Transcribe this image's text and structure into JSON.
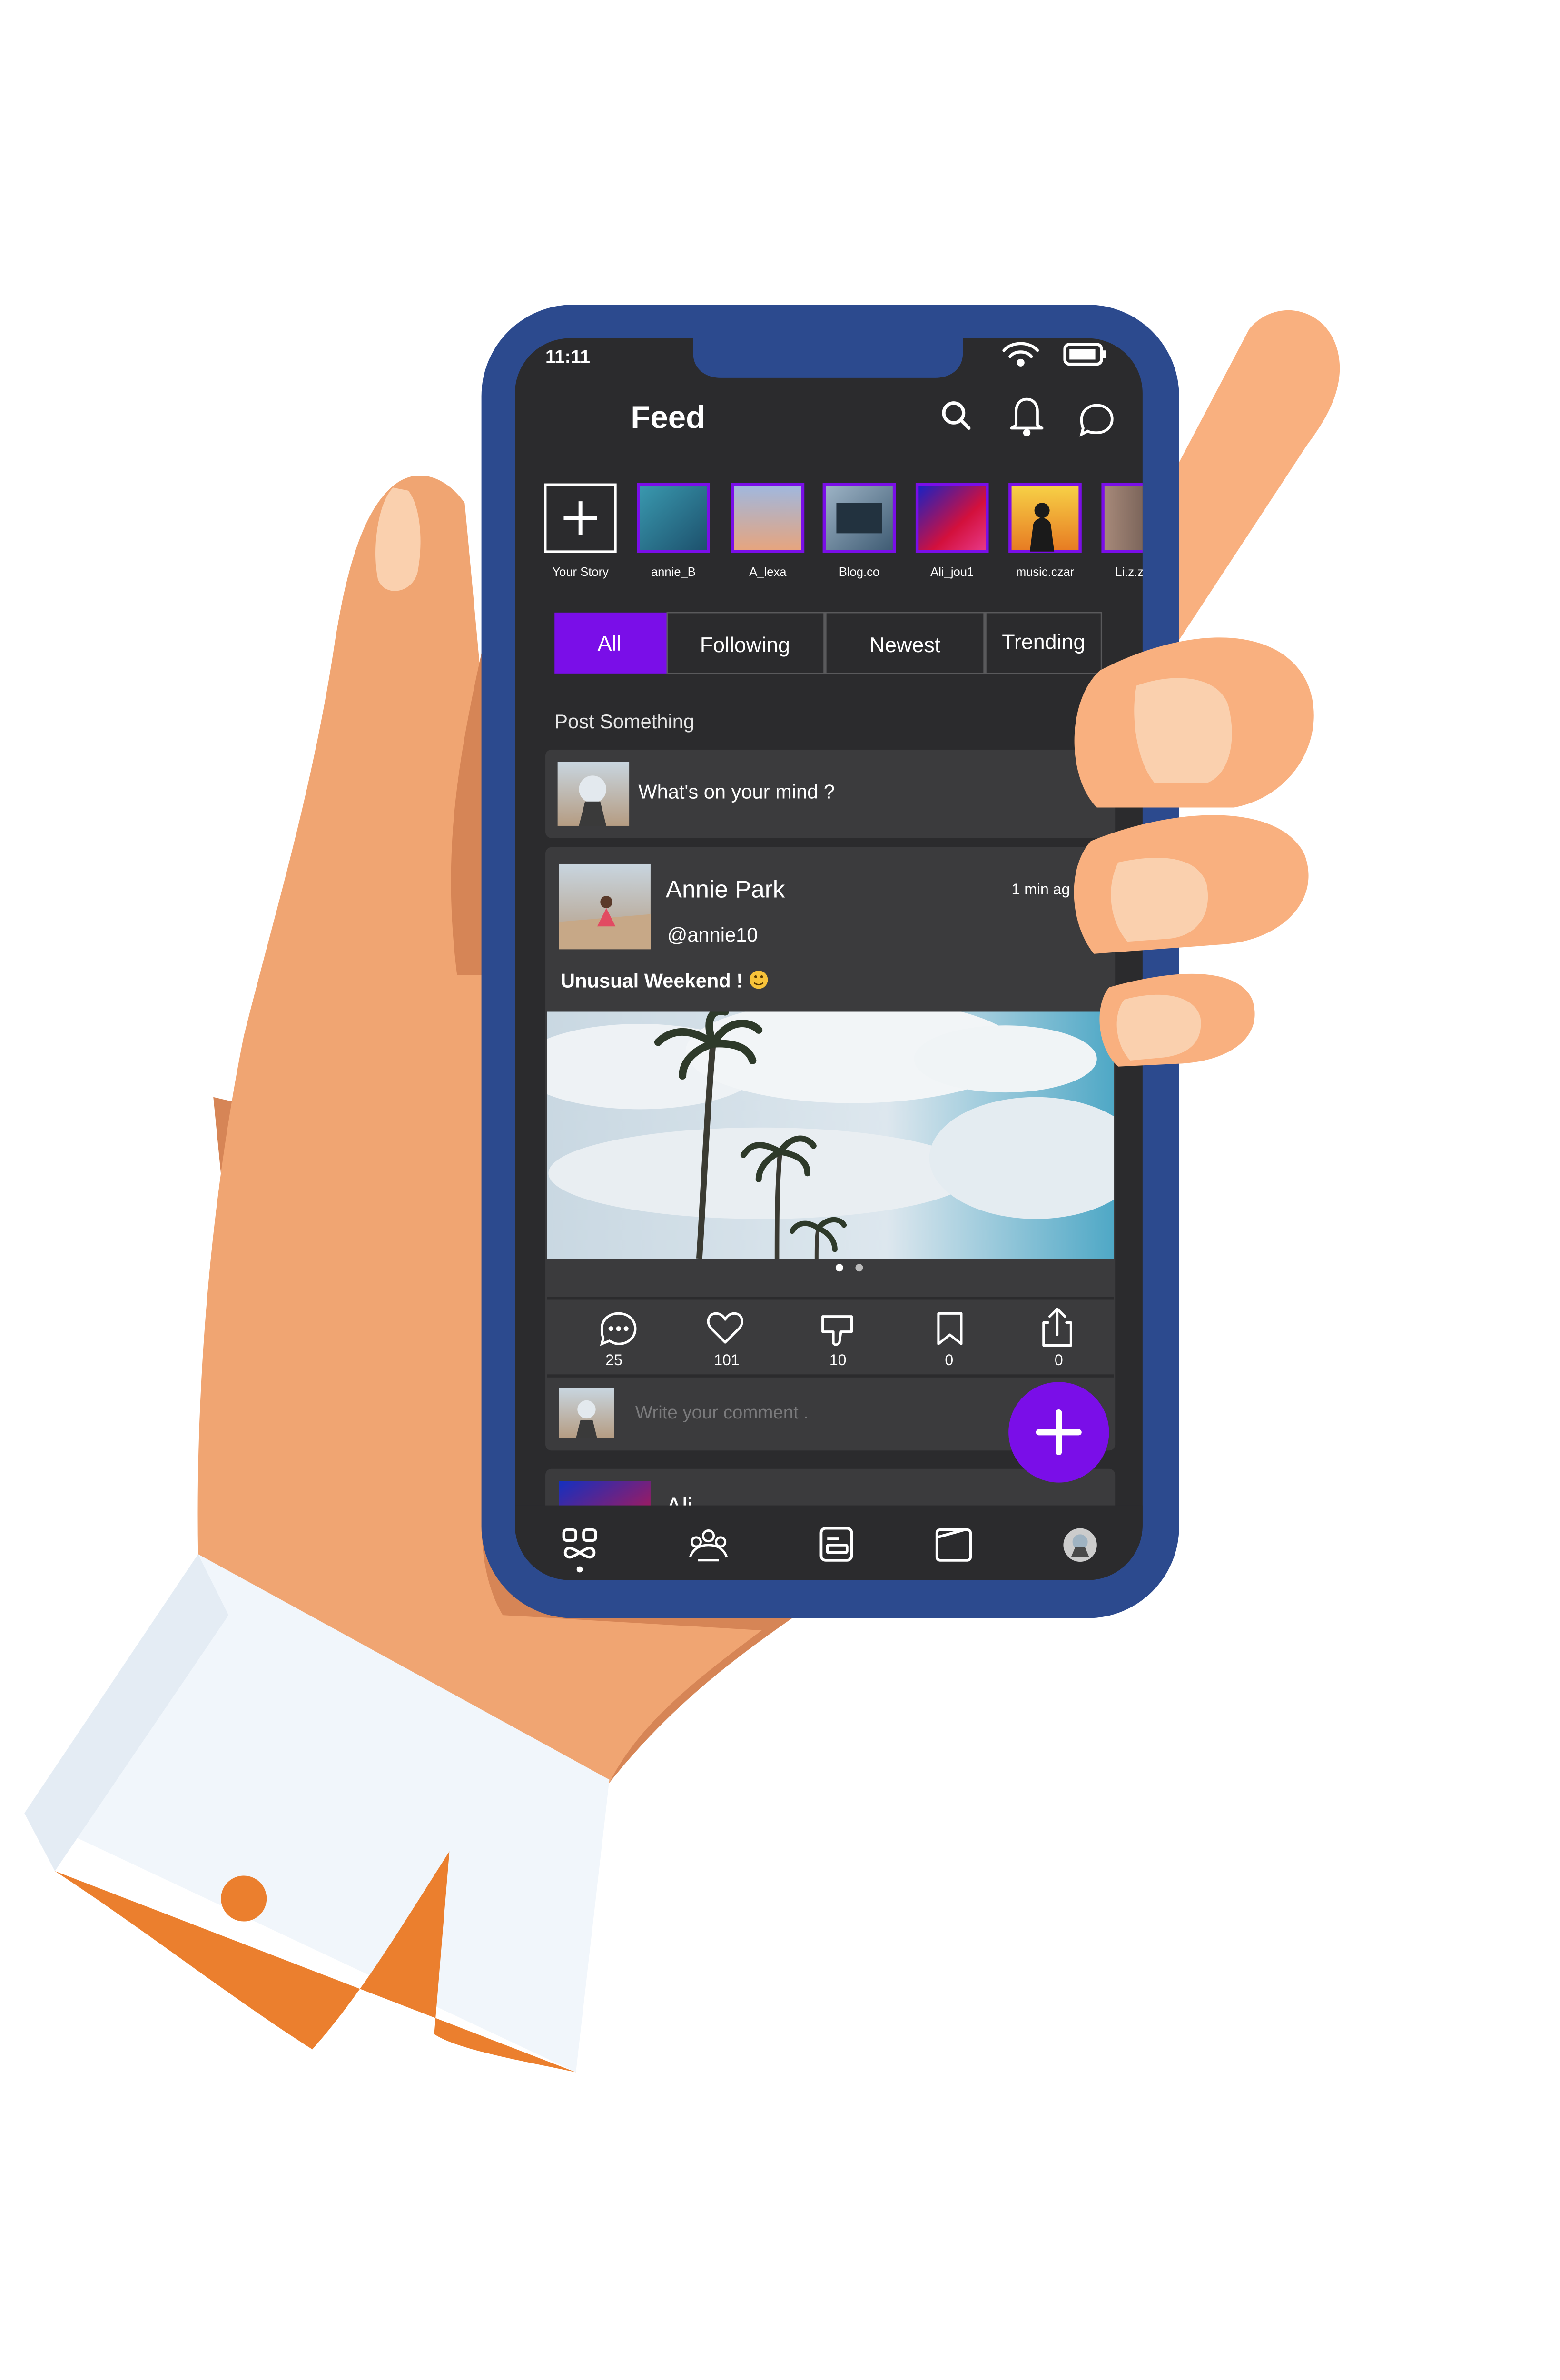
{
  "status_bar": {
    "time": "11:11"
  },
  "header": {
    "title": "Feed",
    "icons": [
      "search-icon",
      "bell-icon",
      "chat-icon"
    ]
  },
  "stories": [
    {
      "label": "Your Story"
    },
    {
      "label": "annie_B"
    },
    {
      "label": "A_lexa"
    },
    {
      "label": "Blog.co"
    },
    {
      "label": "Ali_jou1"
    },
    {
      "label": "music.czar"
    },
    {
      "label": "Li.z.z"
    }
  ],
  "tabs": [
    {
      "label": "All",
      "active": true
    },
    {
      "label": "Following",
      "active": false
    },
    {
      "label": "Newest",
      "active": false
    },
    {
      "label": "Trending",
      "active": false
    }
  ],
  "composer": {
    "section_label": "Post Something",
    "placeholder": "What's on your mind ?"
  },
  "post": {
    "author": "Annie Park",
    "handle": "@annie10",
    "time": "1 min ag",
    "caption": "Unusual Weekend !",
    "carousel": {
      "count": 2,
      "active": 1
    },
    "actions": [
      {
        "icon": "comment-icon",
        "count": "25"
      },
      {
        "icon": "heart-icon",
        "count": "101"
      },
      {
        "icon": "dislike-icon",
        "count": "10"
      },
      {
        "icon": "bookmark-icon",
        "count": "0"
      },
      {
        "icon": "share-icon",
        "count": "0"
      }
    ],
    "comment_placeholder": "Write your comment ."
  },
  "next_post": {
    "author": "Ali"
  },
  "bottom_nav": [
    "feed-icon",
    "community-icon",
    "posts-icon",
    "wallet-icon",
    "profile-avatar"
  ],
  "colors": {
    "accent": "#7A0EE8",
    "phone_frame": "#2C4A8E",
    "screen_bg": "#2B2B2D",
    "card_bg": "#3B3B3D",
    "skin": "#F0A572",
    "skin_shadow": "#D68556",
    "cuff": "#F1F6FB",
    "cuff_orange": "#EB7F2E"
  }
}
